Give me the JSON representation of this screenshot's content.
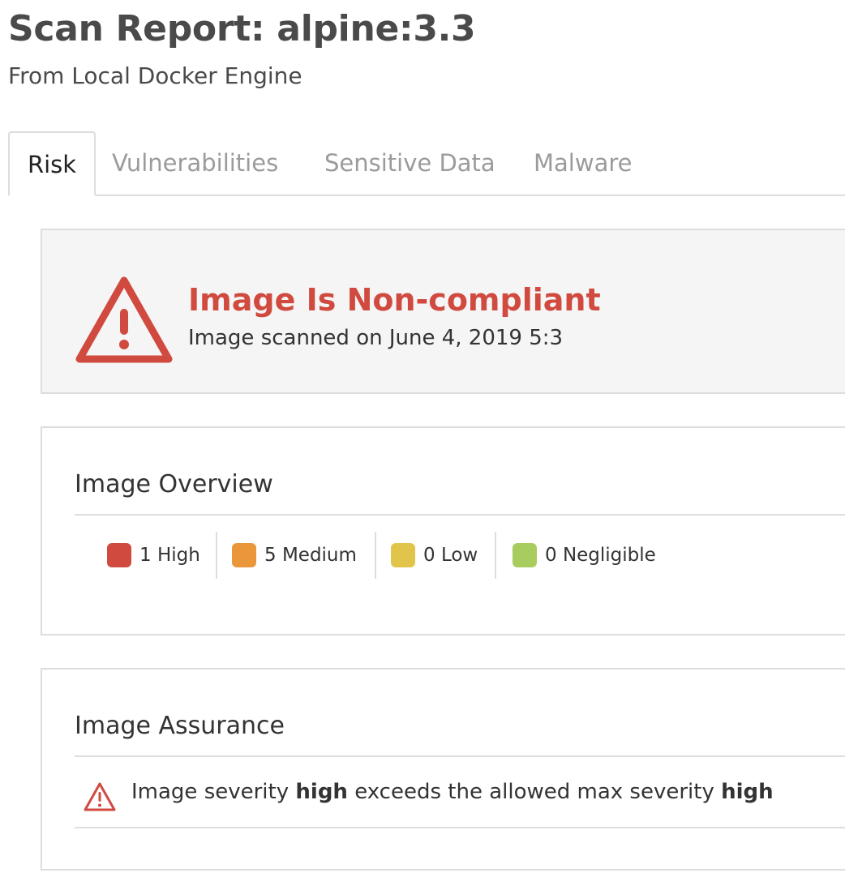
{
  "header": {
    "title": "Scan Report: alpine:3.3",
    "subtitle": "From Local Docker Engine"
  },
  "tabs": [
    {
      "label": "Risk",
      "active": true
    },
    {
      "label": "Vulnerabilities",
      "active": false
    },
    {
      "label": "Sensitive Data",
      "active": false
    },
    {
      "label": "Malware",
      "active": false
    }
  ],
  "status": {
    "icon": "warning-triangle-icon",
    "title": "Image Is Non-compliant",
    "scanned": "Image scanned on June 4, 2019 5:3",
    "color": "#d04a3f"
  },
  "overview": {
    "heading": "Image Overview",
    "severities": [
      {
        "label": "1 High",
        "color": "#d04a3f"
      },
      {
        "label": "5 Medium",
        "color": "#ea963b"
      },
      {
        "label": "0 Low",
        "color": "#e0c54a"
      },
      {
        "label": "0 Negligible",
        "color": "#a9cc5f"
      }
    ]
  },
  "assurance": {
    "heading": "Image Assurance",
    "icon": "warning-triangle-icon",
    "text_prefix": "Image severity ",
    "severity": "high",
    "text_middle": " exceeds the allowed max severity ",
    "max_severity": "high"
  }
}
